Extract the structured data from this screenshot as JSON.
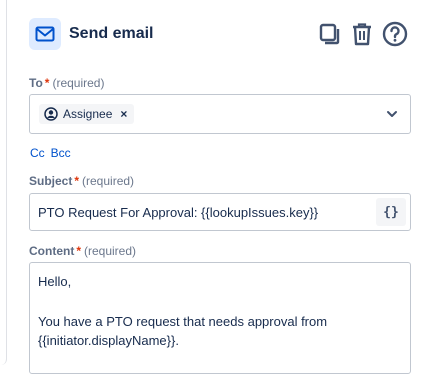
{
  "header": {
    "title": "Send email",
    "icons": [
      "email-icon",
      "copy-icon",
      "trash-icon",
      "help-icon"
    ]
  },
  "to_field": {
    "label": "To",
    "required_star": "*",
    "required_text": "(required)",
    "chip_label": "Assignee",
    "chip_remove": "×"
  },
  "links": {
    "cc": "Cc",
    "bcc": "Bcc"
  },
  "subject_field": {
    "label": "Subject",
    "required_star": "*",
    "required_text": "(required)",
    "value": "PTO Request For Approval: {{lookupIssues.key}}",
    "smart_value_button": "{}"
  },
  "content_field": {
    "label": "Content",
    "required_star": "*",
    "required_text": "(required)",
    "lines": [
      "Hello,",
      "",
      "You have a PTO request that needs approval from",
      "{{initiator.displayName}}."
    ]
  },
  "colors": {
    "accent": "#0052cc",
    "icon_bg": "#deebff",
    "required": "#de350b",
    "border": "#c1c7d0"
  }
}
